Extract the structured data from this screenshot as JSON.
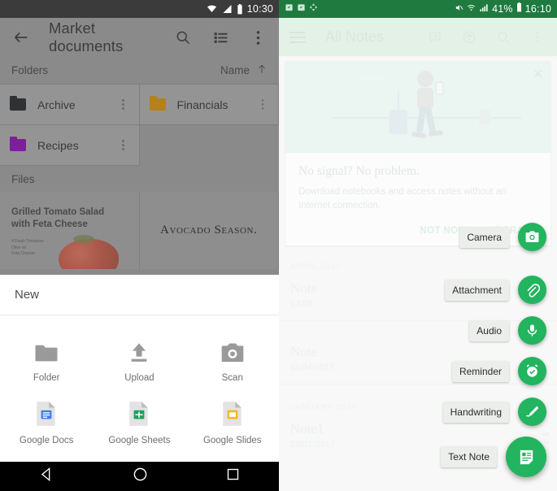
{
  "drive": {
    "status": {
      "time": "10:30",
      "icons": [
        "wifi-icon",
        "signal-icon",
        "battery-icon"
      ]
    },
    "appbar": {
      "back_icon": "back-arrow-icon",
      "title": "Market documents",
      "search_icon": "search-icon",
      "view_list_icon": "view-list-icon",
      "overflow_icon": "overflow-menu-icon"
    },
    "folders_section": {
      "label": "Folders",
      "sort_label": "Name",
      "sort_icon": "arrow-up-icon"
    },
    "folders": [
      {
        "name": "Archive",
        "color": "#2f3133",
        "menu_icon": "overflow-menu-icon"
      },
      {
        "name": "Financials",
        "color": "#b5811c",
        "menu_icon": "overflow-menu-icon"
      },
      {
        "name": "Recipes",
        "color": "#7d1f9c",
        "menu_icon": "overflow-menu-icon"
      }
    ],
    "files_section": {
      "label": "Files"
    },
    "files": [
      {
        "title": "Grilled Tomato Salad\nwith Feta Cheese",
        "ingredients": "4 Fresh Tomatoes\nOlive oil\nFeta Cheese"
      },
      {
        "title": "Avocado Season."
      }
    ],
    "sheet": {
      "title": "New",
      "items": [
        {
          "label": "Folder",
          "icon": "folder-icon"
        },
        {
          "label": "Upload",
          "icon": "upload-icon"
        },
        {
          "label": "Scan",
          "icon": "camera-icon"
        },
        {
          "label": "Google Docs",
          "icon": "google-docs-icon"
        },
        {
          "label": "Google Sheets",
          "icon": "google-sheets-icon"
        },
        {
          "label": "Google Slides",
          "icon": "google-slides-icon"
        }
      ]
    },
    "navbar": {
      "back": "nav-back-icon",
      "home": "nav-home-icon",
      "recents": "nav-recents-icon"
    }
  },
  "evernote": {
    "status": {
      "time": "16:10",
      "battery": "41%",
      "left_icons": [
        "evernote-notification-icon",
        "evernote-notification-icon",
        "sync-icon"
      ],
      "right_icons": [
        "mute-icon",
        "wifi-icon",
        "signal-icon",
        "battery-icon"
      ]
    },
    "appbar": {
      "menu_icon": "hamburger-menu-icon",
      "title": "All Notes",
      "actions": [
        "work-chat-icon",
        "upload-circle-icon",
        "search-icon",
        "overflow-menu-icon"
      ]
    },
    "promo": {
      "close_icon": "close-icon",
      "heading": "No signal? No problem.",
      "body": "Download notebooks and access notes without an Internet connection.",
      "primary": "NOT NOW",
      "secondary": "UPGRADE",
      "illustration": "traveler-with-phone-illustration"
    },
    "notes": [
      {
        "month": "APRIL 2017",
        "title": "Note",
        "date": "13:08"
      },
      {
        "month": "",
        "title": "Note",
        "date": "11/04/2017"
      },
      {
        "month": "JANUARY 2017",
        "title": "Note1",
        "date": "29/01/2017"
      }
    ],
    "speed_dial": {
      "accent": "#22b45e",
      "items": [
        {
          "label": "Camera",
          "icon": "camera-icon",
          "main": false
        },
        {
          "label": "Attachment",
          "icon": "paperclip-icon",
          "main": false
        },
        {
          "label": "Audio",
          "icon": "microphone-icon",
          "main": false
        },
        {
          "label": "Reminder",
          "icon": "alarm-clock-icon",
          "main": false
        },
        {
          "label": "Handwriting",
          "icon": "pen-icon",
          "main": false
        },
        {
          "label": "Text Note",
          "icon": "text-note-icon",
          "main": true
        }
      ]
    }
  }
}
